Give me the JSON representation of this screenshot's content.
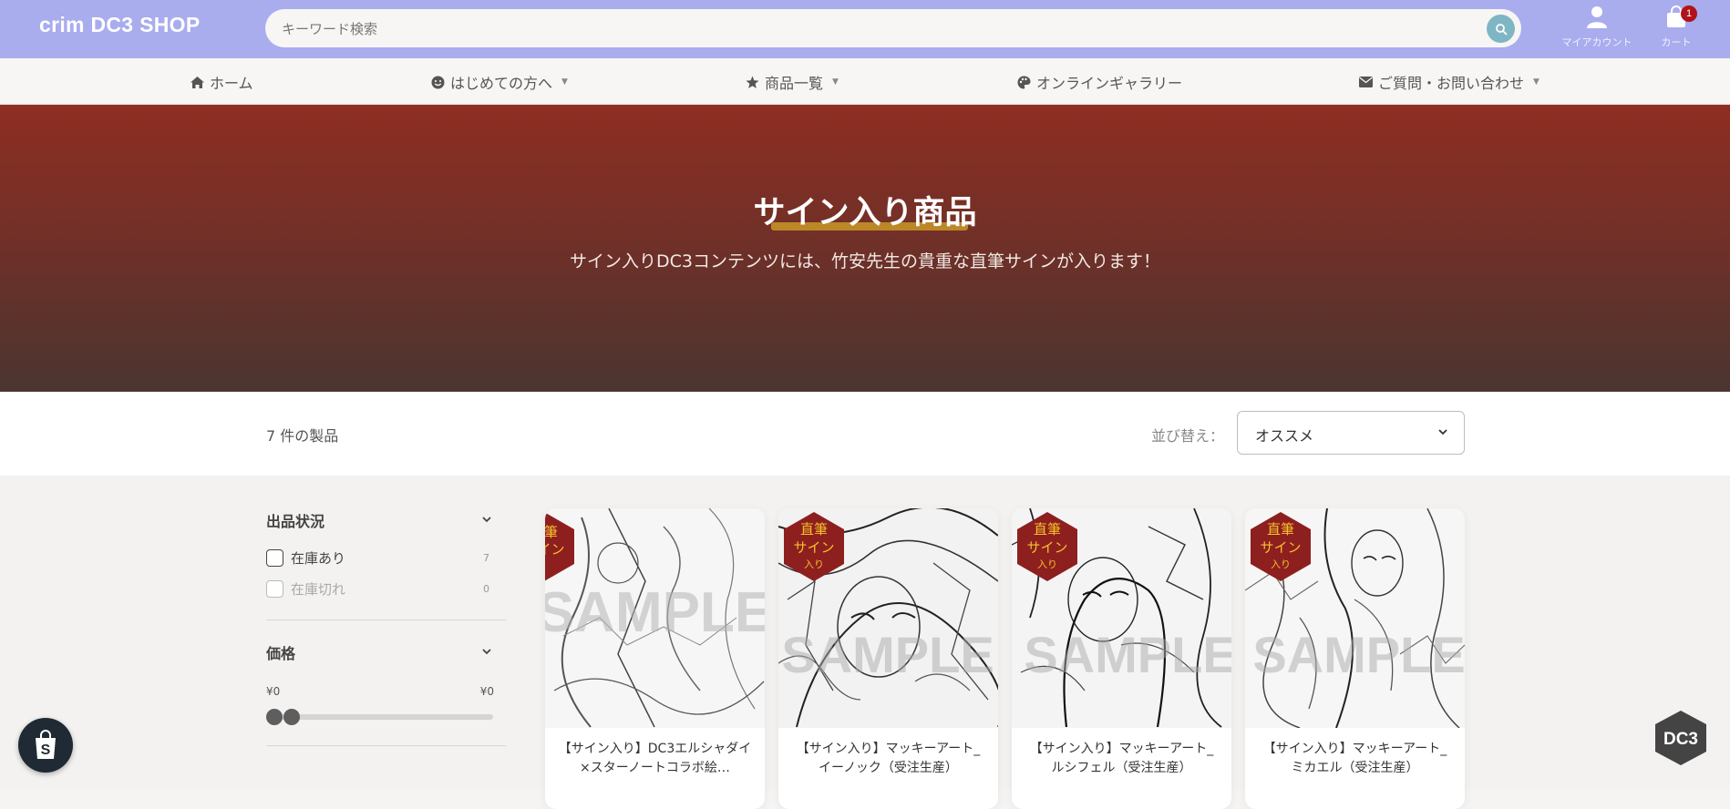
{
  "header": {
    "logo": "crim DC3 SHOP",
    "search_placeholder": "キーワード検索",
    "account_label": "マイアカウント",
    "cart_label": "カート",
    "cart_count": "1"
  },
  "nav": {
    "items": [
      {
        "label": "ホーム",
        "icon": "home-icon",
        "has_dropdown": false
      },
      {
        "label": "はじめての方へ",
        "icon": "smile-icon",
        "has_dropdown": true
      },
      {
        "label": "商品一覧",
        "icon": "star-icon",
        "has_dropdown": true
      },
      {
        "label": "オンラインギャラリー",
        "icon": "palette-icon",
        "has_dropdown": false
      },
      {
        "label": "ご質問・お問い合わせ",
        "icon": "envelope-icon",
        "has_dropdown": true
      }
    ]
  },
  "hero": {
    "title": "サイン入り商品",
    "subtitle": "サイン入りDC3コンテンツには、竹安先生の貴重な直筆サインが入ります！"
  },
  "toolbar": {
    "count": "7 件の製品",
    "sort_label": "並び替え：",
    "sort_value": "オススメ"
  },
  "filters": {
    "availability": {
      "title": "出品状況",
      "options": [
        {
          "label": "在庫あり",
          "count": "7",
          "disabled": false
        },
        {
          "label": "在庫切れ",
          "count": "0",
          "disabled": true
        }
      ]
    },
    "price": {
      "title": "価格",
      "min": "¥0",
      "max": "¥0",
      "slider_min_fraction": 0,
      "slider_max_fraction": 0
    }
  },
  "badge": {
    "line1": "直筆",
    "line2": "サイン",
    "line3": "入り"
  },
  "products": [
    {
      "title": "【サイン入り】DC3エルシャダイ×スターノートコラボ絵…",
      "badge_partial": true
    },
    {
      "title": "【サイン入り】マッキーアート_イーノック（受注生産）",
      "badge_partial": false
    },
    {
      "title": "【サイン入り】マッキーアート_ルシフェル（受注生産）",
      "badge_partial": false
    },
    {
      "title": "【サイン入り】マッキーアート_ミカエル（受注生産）",
      "badge_partial": false
    }
  ],
  "floating": {
    "brand_mark": "DC3"
  },
  "colors": {
    "header_bg": "#a9aced",
    "hero_top": "#8f2e22",
    "hero_bottom": "#4b3531",
    "accent_teal": "#7fb6c4",
    "badge_red": "#8e1f1f",
    "badge_text": "#f5c12b",
    "cart_badge": "#b1131a"
  }
}
